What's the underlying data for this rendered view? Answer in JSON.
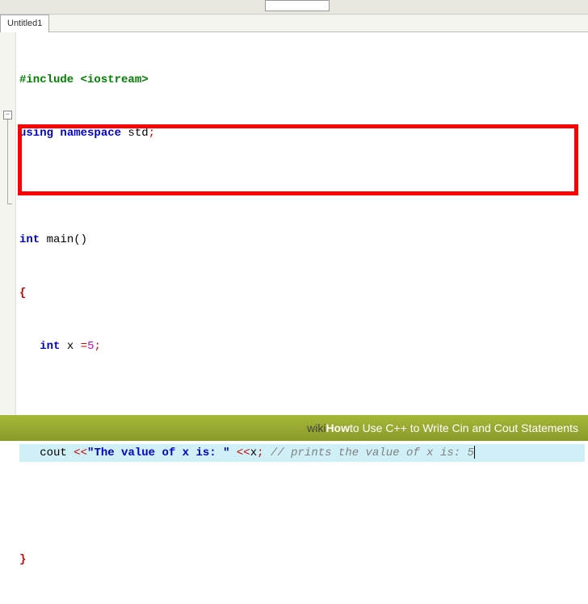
{
  "tab": {
    "title": "Untitled1"
  },
  "code": {
    "l1_include": "#include",
    "l1_header": " <iostream>",
    "l2_using": "using",
    "l2_namespace": " namespace",
    "l2_std": " std",
    "l2_semi": ";",
    "l4_int": "int",
    "l4_main": " main",
    "l4_paren": "()",
    "l5_brace": "{",
    "l6_int": "int",
    "l6_x": " x ",
    "l6_eq": "=",
    "l6_val": "5",
    "l6_semi": ";",
    "l8_cout": "cout ",
    "l8_op1": "<<",
    "l8_str": "\"The value of x is: \"",
    "l8_op2": " <<",
    "l8_x": "x",
    "l8_semi": ";",
    "l8_comment": " // prints the value of x is: 5",
    "l10_brace": "}"
  },
  "gutter": {
    "fold_symbol": "−"
  },
  "footer": {
    "wiki": "wiki",
    "how": "How",
    "rest": " to Use C++ to Write Cin and Cout Statements"
  }
}
